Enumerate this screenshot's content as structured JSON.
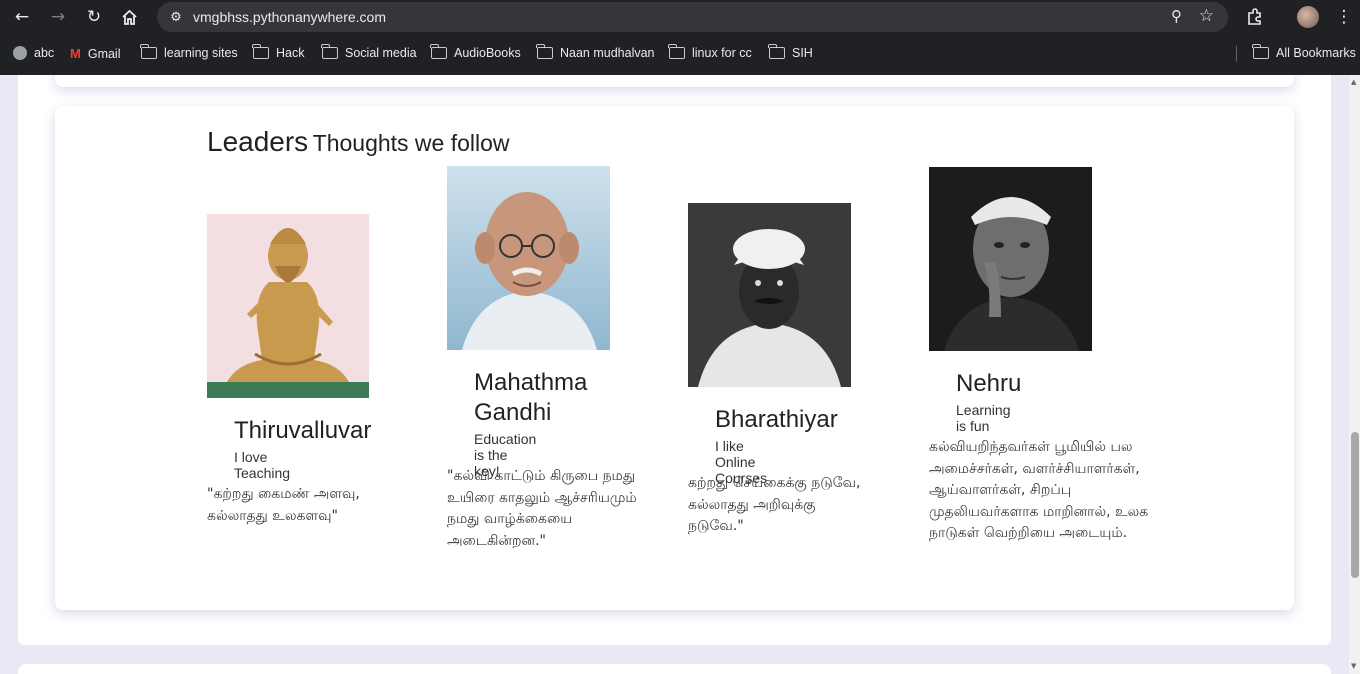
{
  "browser": {
    "url": "vmgbhss.pythonanywhere.com",
    "icons": [
      "back-icon",
      "forward-icon",
      "reload-icon",
      "home-icon",
      "site-settings-icon",
      "zoom-icon",
      "bookmark-star-icon",
      "extensions-icon",
      "profile-avatar",
      "menu-icon"
    ],
    "bookmarks": [
      "abc",
      "Gmail",
      "learning sites",
      "Hack",
      "Social media",
      "AudioBooks",
      "Naan mudhalvan",
      "linux for cc",
      "SIH"
    ],
    "all_bookmarks": "All Bookmarks"
  },
  "section": {
    "title_main": "Leaders",
    "title_sub": "Thoughts we follow"
  },
  "leaders": [
    {
      "name": "Thiruvalluvar",
      "tagline": "I love Teaching",
      "quote": "\"கற்றது கைமண் அளவு, கல்லாதது உலகளவு\""
    },
    {
      "name": "Mahathma Gandhi",
      "tagline": "Education is the key!",
      "quote": "\"கல்வி காட்டும் கிருபை நமது உயிரை காதலும் ஆச்சரியமும் நமது வாழ்க்கையை அடைகின்றன.\""
    },
    {
      "name": "Bharathiyar",
      "tagline": "I like Online Courses",
      "quote": "கற்றது செய்கைக்கு நடுவே, கல்லாதது அறிவுக்கு நடுவே.\""
    },
    {
      "name": "Nehru",
      "tagline": "Learning is fun",
      "quote": "கல்வியறிந்தவர்கள் பூமியில் பல அமைச்சர்கள், வளர்ச்சியாளர்கள், ஆய்வாளர்கள், சிறப்பு முதலியவர்களாக மாறினால், உலக நாடுகள் வெற்றியை அடையும்."
    }
  ],
  "colors": {
    "chrome_bg": "#202124",
    "omnibox_bg": "#35363a",
    "page_bg": "#e9e9f6",
    "card_bg": "#ffffff"
  }
}
